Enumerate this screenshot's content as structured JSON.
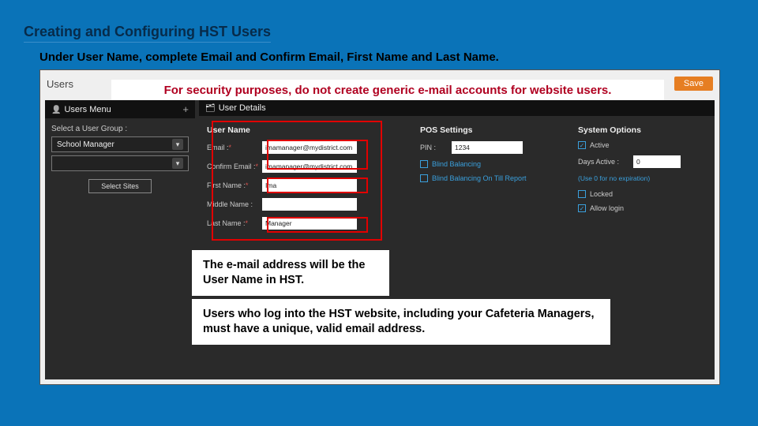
{
  "title": "Creating  and Configuring HST Users",
  "instruction": "Under User Name, complete Email and Confirm Email, First Name and Last Name.",
  "security_banner": "For security purposes, do not create generic e-mail accounts for website users.",
  "app": {
    "page_label": "Users",
    "save_label": "Save",
    "left": {
      "menu_header": "Users Menu",
      "group_label": "Select a User Group :",
      "group_value": "School Manager",
      "select_sites_label": "Select Sites"
    },
    "details": {
      "header": "User Details",
      "user_name_section": "User Name",
      "fields": {
        "email_label": "Email :",
        "email_value": "imamanager@mydistrict.com",
        "confirm_label": "Confirm Email :",
        "confirm_value": "imamanager@mydistrict.com",
        "first_label": "First Name :",
        "first_value": "Ima",
        "middle_label": "Middle Name :",
        "middle_value": "",
        "last_label": "Last Name :",
        "last_value": "Manager",
        "required_mark": "*"
      },
      "pos": {
        "header": "POS Settings",
        "pin_label": "PIN :",
        "pin_value": "1234",
        "blind_label": "Blind Balancing",
        "blind_till_label": "Blind Balancing On Till Report"
      },
      "sys": {
        "header": "System Options",
        "active_label": "Active",
        "days_label": "Days Active :",
        "days_value": "0",
        "days_hint": "(Use 0 for no expiration)",
        "locked_label": "Locked",
        "allow_login_label": "Allow login"
      }
    }
  },
  "callouts": {
    "c1": "The e-mail address will be the User Name in HST.",
    "c2": "Users who log into the HST website, including your Cafeteria Managers, must have a unique, valid email address."
  }
}
